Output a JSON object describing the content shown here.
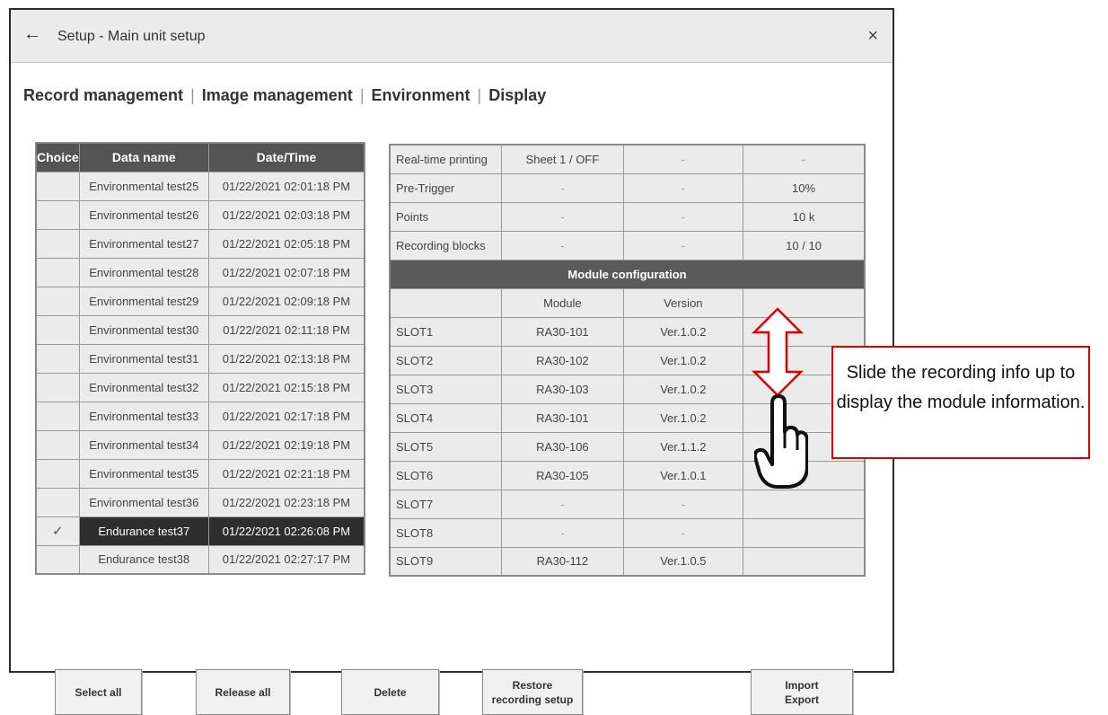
{
  "window": {
    "title": "Setup - Main unit setup",
    "back_icon": "←",
    "close_icon": "×"
  },
  "tabs": [
    "Record management",
    "Image management",
    "Environment",
    "Display"
  ],
  "record_table": {
    "headers": [
      "Choice",
      "Data name",
      "Date/Time"
    ],
    "rows": [
      {
        "choice": "",
        "name": "Environmental test25",
        "datetime": "01/22/2021 02:01:18 PM"
      },
      {
        "choice": "",
        "name": "Environmental test26",
        "datetime": "01/22/2021 02:03:18 PM"
      },
      {
        "choice": "",
        "name": "Environmental test27",
        "datetime": "01/22/2021 02:05:18 PM"
      },
      {
        "choice": "",
        "name": "Environmental test28",
        "datetime": "01/22/2021 02:07:18 PM"
      },
      {
        "choice": "",
        "name": "Environmental test29",
        "datetime": "01/22/2021 02:09:18 PM"
      },
      {
        "choice": "",
        "name": "Environmental test30",
        "datetime": "01/22/2021 02:11:18 PM"
      },
      {
        "choice": "",
        "name": "Environmental test31",
        "datetime": "01/22/2021 02:13:18 PM"
      },
      {
        "choice": "",
        "name": "Environmental test32",
        "datetime": "01/22/2021 02:15:18 PM"
      },
      {
        "choice": "",
        "name": "Environmental test33",
        "datetime": "01/22/2021 02:17:18 PM"
      },
      {
        "choice": "",
        "name": "Environmental test34",
        "datetime": "01/22/2021 02:19:18 PM"
      },
      {
        "choice": "",
        "name": "Environmental test35",
        "datetime": "01/22/2021 02:21:18 PM"
      },
      {
        "choice": "",
        "name": "Environmental test36",
        "datetime": "01/22/2021 02:23:18 PM"
      },
      {
        "choice": "✓",
        "name": "Endurance test37",
        "datetime": "01/22/2021 02:26:08 PM",
        "selected": true
      },
      {
        "choice": "",
        "name": "Endurance test38",
        "datetime": "01/22/2021 02:27:17 PM"
      }
    ]
  },
  "info_table": {
    "recording_rows": [
      [
        "Real-time printing",
        "Sheet 1 / OFF",
        "-",
        "-"
      ],
      [
        "Pre-Trigger",
        "-",
        "-",
        "10%"
      ],
      [
        "Points",
        "-",
        "-",
        "10 k"
      ],
      [
        "Recording blocks",
        "-",
        "-",
        "10 / 10"
      ]
    ],
    "module_header": "Module configuration",
    "module_columns": [
      "",
      "Module",
      "Version",
      ""
    ],
    "module_rows": [
      [
        "SLOT1",
        "RA30-101",
        "Ver.1.0.2",
        ""
      ],
      [
        "SLOT2",
        "RA30-102",
        "Ver.1.0.2",
        ""
      ],
      [
        "SLOT3",
        "RA30-103",
        "Ver.1.0.2",
        ""
      ],
      [
        "SLOT4",
        "RA30-101",
        "Ver.1.0.2",
        ""
      ],
      [
        "SLOT5",
        "RA30-106",
        "Ver.1.1.2",
        ""
      ],
      [
        "SLOT6",
        "RA30-105",
        "Ver.1.0.1",
        ""
      ],
      [
        "SLOT7",
        "-",
        "-",
        ""
      ],
      [
        "SLOT8",
        "-",
        "-",
        ""
      ],
      [
        "SLOT9",
        "RA30-112",
        "Ver.1.0.5",
        ""
      ]
    ]
  },
  "buttons": {
    "select_all": "Select all",
    "release_all": "Release all",
    "delete": "Delete",
    "restore": "Restore\nrecording setup",
    "import_export": "Import\nExport"
  },
  "callout": {
    "text": "Slide the recording info up to display the module information."
  },
  "colors": {
    "accent_red": "#e00000",
    "header_dark": "#545454",
    "cell_bg": "#ebebeb"
  }
}
